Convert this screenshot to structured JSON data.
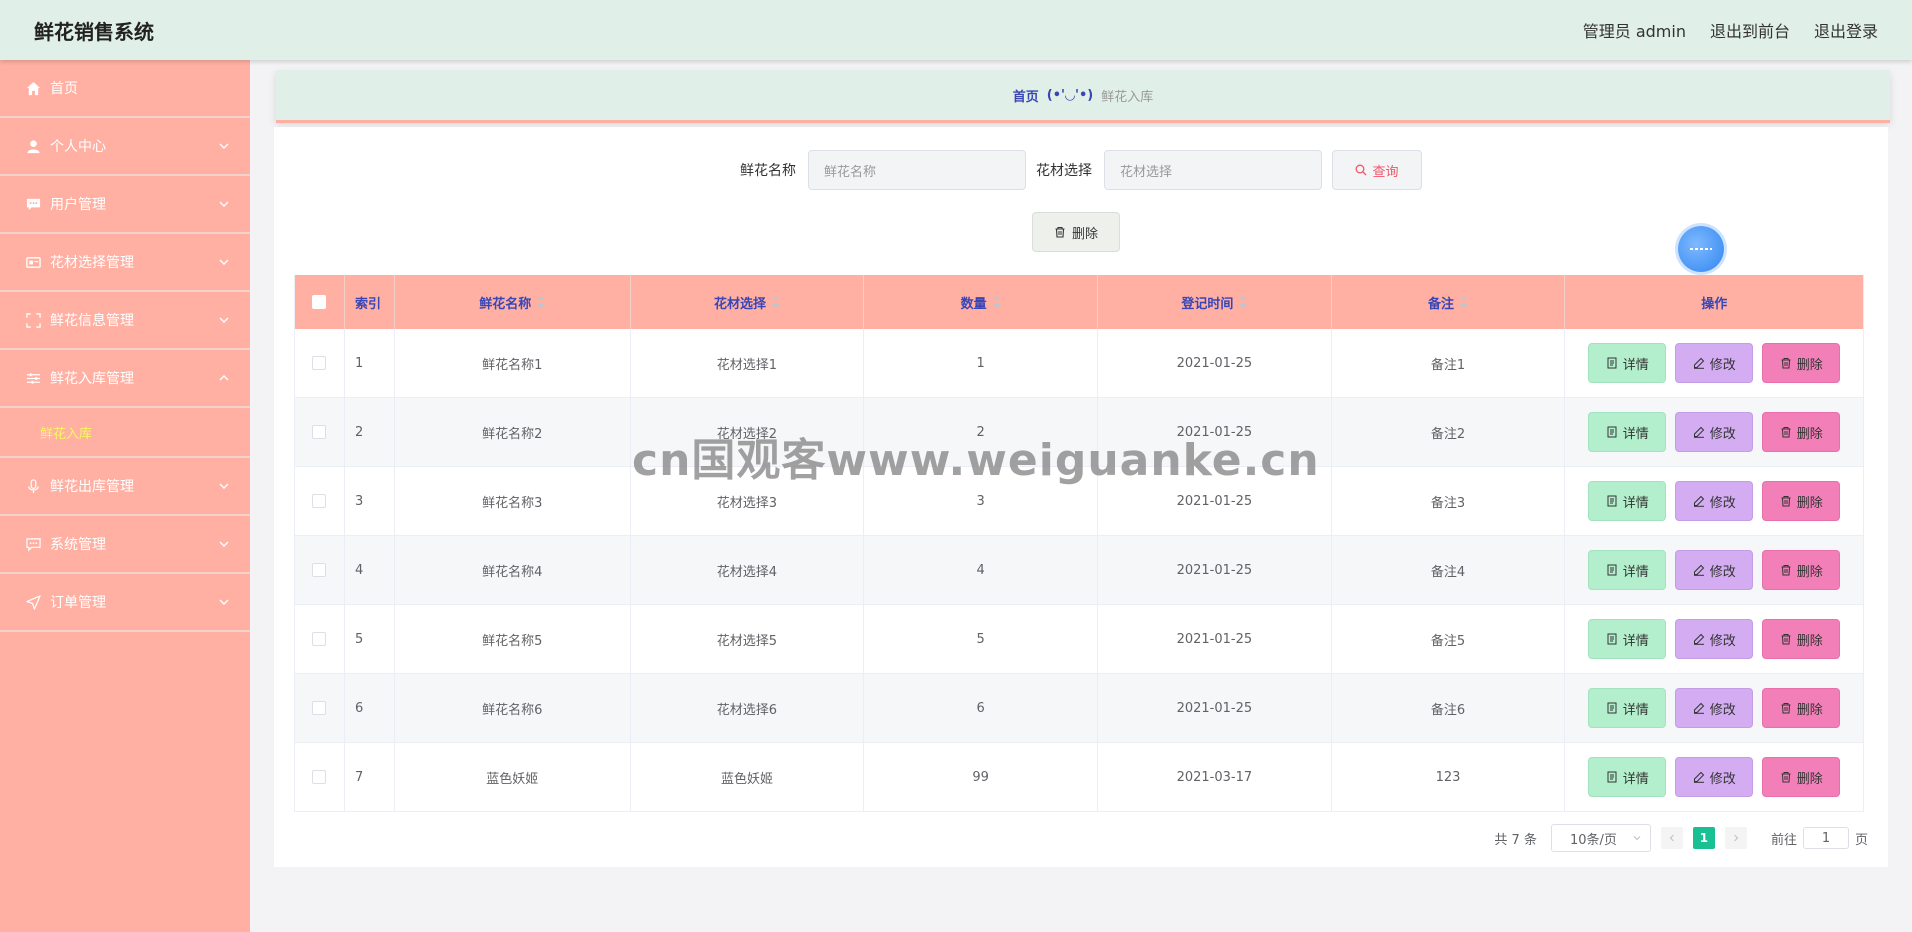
{
  "header": {
    "title": "鲜花销售系统",
    "user": "管理员 admin",
    "exit_front": "退出到前台",
    "logout": "退出登录"
  },
  "sidebar": {
    "items": [
      {
        "label": "首页",
        "icon": "home-icon"
      },
      {
        "label": "个人中心",
        "icon": "user-icon"
      },
      {
        "label": "用户管理",
        "icon": "chat-icon"
      },
      {
        "label": "花材选择管理",
        "icon": "card-icon"
      },
      {
        "label": "鲜花信息管理",
        "icon": "scan-icon"
      },
      {
        "label": "鲜花入库管理",
        "icon": "sliders-icon"
      },
      {
        "label": "鲜花出库管理",
        "icon": "mic-icon"
      },
      {
        "label": "系统管理",
        "icon": "message-icon"
      },
      {
        "label": "订单管理",
        "icon": "send-icon"
      }
    ],
    "submenu": {
      "label": "鲜花入库"
    }
  },
  "breadcrumb": {
    "home": "首页",
    "sep": "(•'◡'•)",
    "current": "鲜花入库"
  },
  "search": {
    "name_label": "鲜花名称",
    "name_placeholder": "鲜花名称",
    "material_label": "花材选择",
    "material_placeholder": "花材选择",
    "query_label": "查询"
  },
  "toolbar": {
    "delete_label": "删除"
  },
  "table": {
    "headers": [
      "索引",
      "鲜花名称",
      "花材选择",
      "数量",
      "登记时间",
      "备注",
      "操作"
    ],
    "rows": [
      {
        "index": "1",
        "name": "鲜花名称1",
        "material": "花材选择1",
        "qty": "1",
        "date": "2021-01-25",
        "note": "备注1"
      },
      {
        "index": "2",
        "name": "鲜花名称2",
        "material": "花材选择2",
        "qty": "2",
        "date": "2021-01-25",
        "note": "备注2"
      },
      {
        "index": "3",
        "name": "鲜花名称3",
        "material": "花材选择3",
        "qty": "3",
        "date": "2021-01-25",
        "note": "备注3"
      },
      {
        "index": "4",
        "name": "鲜花名称4",
        "material": "花材选择4",
        "qty": "4",
        "date": "2021-01-25",
        "note": "备注4"
      },
      {
        "index": "5",
        "name": "鲜花名称5",
        "material": "花材选择5",
        "qty": "5",
        "date": "2021-01-25",
        "note": "备注5"
      },
      {
        "index": "6",
        "name": "鲜花名称6",
        "material": "花材选择6",
        "qty": "6",
        "date": "2021-01-25",
        "note": "备注6"
      },
      {
        "index": "7",
        "name": "蓝色妖姬",
        "material": "蓝色妖姬",
        "qty": "99",
        "date": "2021-03-17",
        "note": "123"
      }
    ],
    "actions": {
      "detail": "详情",
      "edit": "修改",
      "delete": "删除"
    }
  },
  "pagination": {
    "total": "共 7 条",
    "page_size": "10条/页",
    "current_page": "1",
    "goto_prefix": "前往",
    "goto_value": "1",
    "goto_suffix": "页"
  },
  "watermark": "cn国观客www.weiguanke.cn",
  "colors": {
    "header_bg": "#e0efe7",
    "sidebar_bg": "#ffb0a3",
    "table_header_bg": "#ffb0a3",
    "header_text": "#3a46b6",
    "detail_btn": "#b3efcd",
    "edit_btn": "#d3acf2",
    "delete_btn": "#f37fb9",
    "pager_active": "#19c093"
  }
}
